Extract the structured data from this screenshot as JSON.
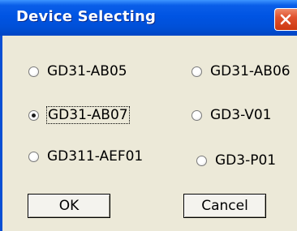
{
  "window": {
    "title": "Device Selecting"
  },
  "devices": [
    {
      "label": "GD31-AB05",
      "checked": false
    },
    {
      "label": "GD31-AB06",
      "checked": false
    },
    {
      "label": "GD31-AB07",
      "checked": true
    },
    {
      "label": "GD3-V01",
      "checked": false
    },
    {
      "label": "GD311-AEF01",
      "checked": false
    },
    {
      "label": "GD3-P01",
      "checked": false
    }
  ],
  "buttons": {
    "ok": "OK",
    "cancel": "Cancel"
  },
  "icons": {
    "close": "close-icon"
  },
  "colors": {
    "titlebar": "#0054e3",
    "close": "#e0512d",
    "dialog": "#ece9d8"
  }
}
